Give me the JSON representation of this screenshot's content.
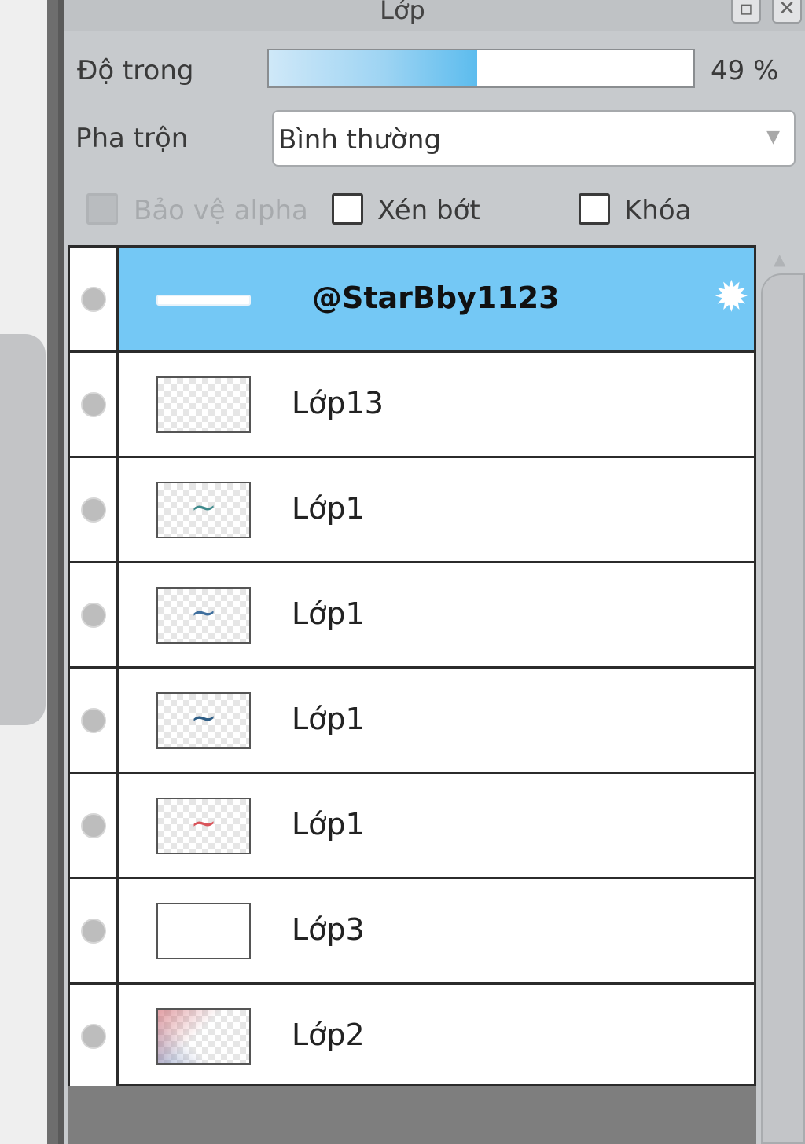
{
  "panel": {
    "title": "Lớp"
  },
  "opacity": {
    "label": "Độ trong",
    "value": 49,
    "display": "49 %"
  },
  "blend": {
    "label": "Pha trộn",
    "value": "Bình thường"
  },
  "options": {
    "protect_alpha": {
      "label": "Bảo vệ alpha",
      "checked": false,
      "enabled": false
    },
    "clip": {
      "label": "Xén bớt",
      "checked": false,
      "enabled": true
    },
    "lock": {
      "label": "Khóa",
      "checked": false,
      "enabled": true
    }
  },
  "layers": [
    {
      "name": "@StarBby1123",
      "selected": true,
      "thumb": "white-line"
    },
    {
      "name": "Lớp13",
      "selected": false,
      "thumb": "empty"
    },
    {
      "name": "Lớp1",
      "selected": false,
      "thumb": "love-teal"
    },
    {
      "name": "Lớp1",
      "selected": false,
      "thumb": "love-blue"
    },
    {
      "name": "Lớp1",
      "selected": false,
      "thumb": "love-navy"
    },
    {
      "name": "Lớp1",
      "selected": false,
      "thumb": "love-red"
    },
    {
      "name": "Lớp3",
      "selected": false,
      "thumb": "faint"
    },
    {
      "name": "Lớp2",
      "selected": false,
      "thumb": "flag"
    }
  ],
  "colors": {
    "selection": "#74c8f5",
    "opacity_fill": "#5cbcee"
  }
}
